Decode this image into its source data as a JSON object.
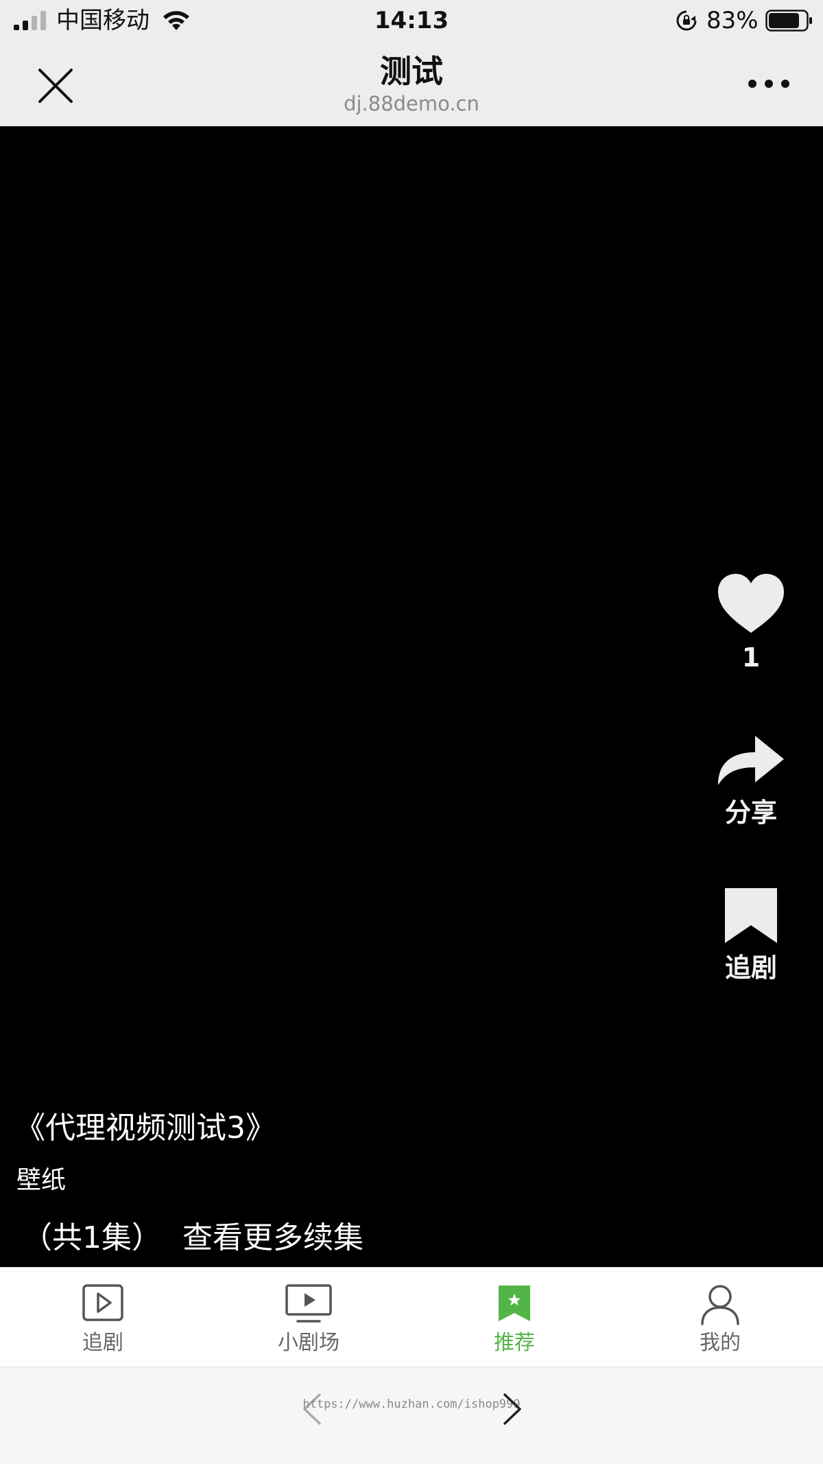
{
  "status_bar": {
    "carrier": "中国移动",
    "time": "14:13",
    "battery_percent": "83%",
    "battery_level": 0.83,
    "signal_bars": 2
  },
  "browser_header": {
    "title": "测试",
    "url": "dj.88demo.cn",
    "close_icon": "close-icon",
    "more_icon": "more-icon"
  },
  "video": {
    "title": "《代理视频测试3》",
    "tag": "壁纸",
    "episodes": "（共1集）",
    "more_episodes": "查看更多续集"
  },
  "side_actions": {
    "like_count": "1",
    "share_label": "分享",
    "follow_label": "追剧"
  },
  "tab_bar": {
    "items": [
      {
        "label": "追剧",
        "icon": "play-square-icon"
      },
      {
        "label": "小剧场",
        "icon": "tv-icon"
      },
      {
        "label": "推荐",
        "icon": "bookmark-star-icon"
      },
      {
        "label": "我的",
        "icon": "user-icon"
      }
    ],
    "active_index": 2
  },
  "toolbar": {
    "watermark": "https://www.huzhan.com/ishop999"
  },
  "colors": {
    "accent": "#52b547",
    "header_bg": "#ededed",
    "video_bg": "#000000"
  }
}
